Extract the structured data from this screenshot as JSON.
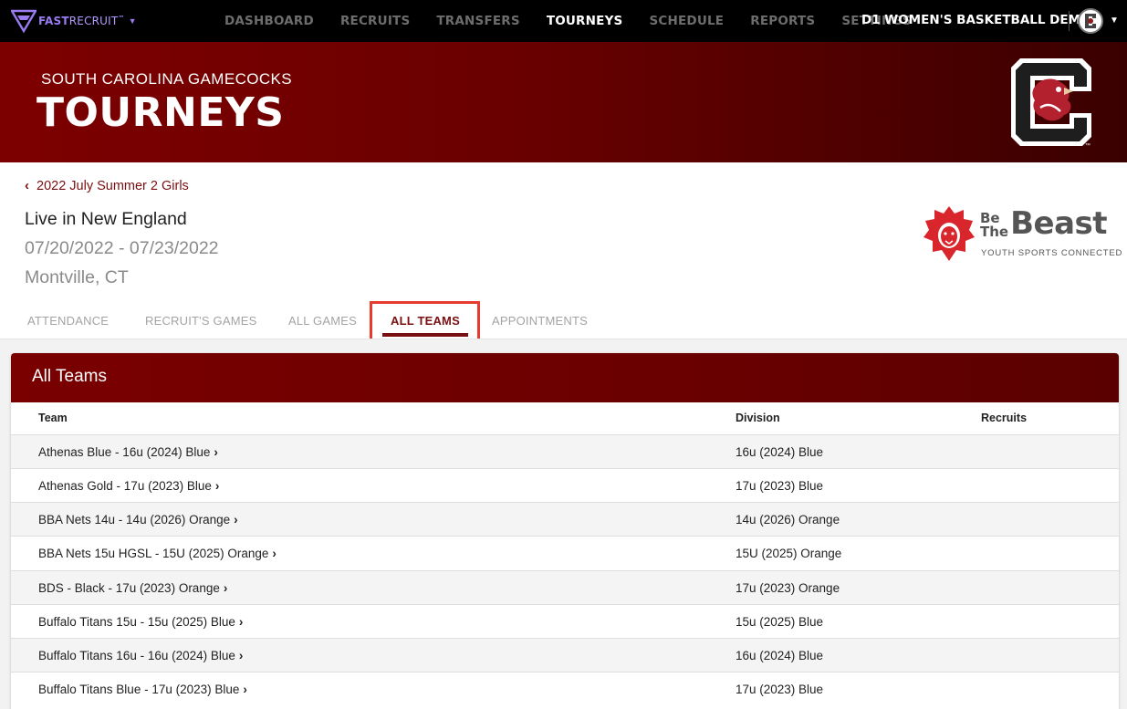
{
  "nav": {
    "brand_bold": "FAST",
    "brand_light": "RECRUIT",
    "brand_tm": "™",
    "items": [
      "DASHBOARD",
      "RECRUITS",
      "TRANSFERS",
      "TOURNEYS",
      "SCHEDULE",
      "REPORTS",
      "SETTINGS"
    ],
    "active": "TOURNEYS",
    "org": "D1 WOMEN'S BASKETBALL DEMO"
  },
  "banner": {
    "subtitle": "SOUTH CAROLINA GAMECOCKS",
    "title": "TOURNEYS",
    "logo_icon": "gamecock-block-c-logo",
    "logo_tm": "™"
  },
  "event": {
    "back_label": "2022 July Summer 2 Girls",
    "name": "Live in New England",
    "dates": "07/20/2022 - 07/23/2022",
    "location": "Montville, CT"
  },
  "sponsor": {
    "be": "Be",
    "the": "The",
    "beast": "Beast",
    "tagline": "YOUTH SPORTS CONNECTED",
    "icon": "lion-head-logo"
  },
  "tabs": [
    "ATTENDANCE",
    "RECRUIT'S GAMES",
    "ALL GAMES",
    "ALL TEAMS",
    "APPOINTMENTS"
  ],
  "active_tab": "ALL TEAMS",
  "table": {
    "title": "All Teams",
    "columns": [
      "Team",
      "Division",
      "Recruits"
    ],
    "rows": [
      {
        "team": "Athenas Blue - 16u (2024) Blue",
        "division": "16u (2024) Blue",
        "recruits": ""
      },
      {
        "team": "Athenas Gold - 17u (2023) Blue",
        "division": "17u (2023) Blue",
        "recruits": ""
      },
      {
        "team": "BBA Nets 14u - 14u (2026) Orange",
        "division": "14u (2026) Orange",
        "recruits": ""
      },
      {
        "team": "BBA Nets 15u HGSL - 15U (2025) Orange",
        "division": "15U (2025) Orange",
        "recruits": ""
      },
      {
        "team": "BDS - Black - 17u (2023) Orange",
        "division": "17u (2023) Orange",
        "recruits": ""
      },
      {
        "team": "Buffalo Titans 15u - 15u (2025) Blue",
        "division": "15u (2025) Blue",
        "recruits": ""
      },
      {
        "team": "Buffalo Titans 16u - 16u (2024) Blue",
        "division": "16u (2024) Blue",
        "recruits": ""
      },
      {
        "team": "Buffalo Titans Blue - 17u (2023) Blue",
        "division": "17u (2023) Blue",
        "recruits": ""
      }
    ]
  },
  "colors": {
    "garnet": "#7a0f12",
    "nav_bg": "#000000",
    "highlight": "#e63b2e",
    "brand_purple": "#9a7cf0"
  }
}
